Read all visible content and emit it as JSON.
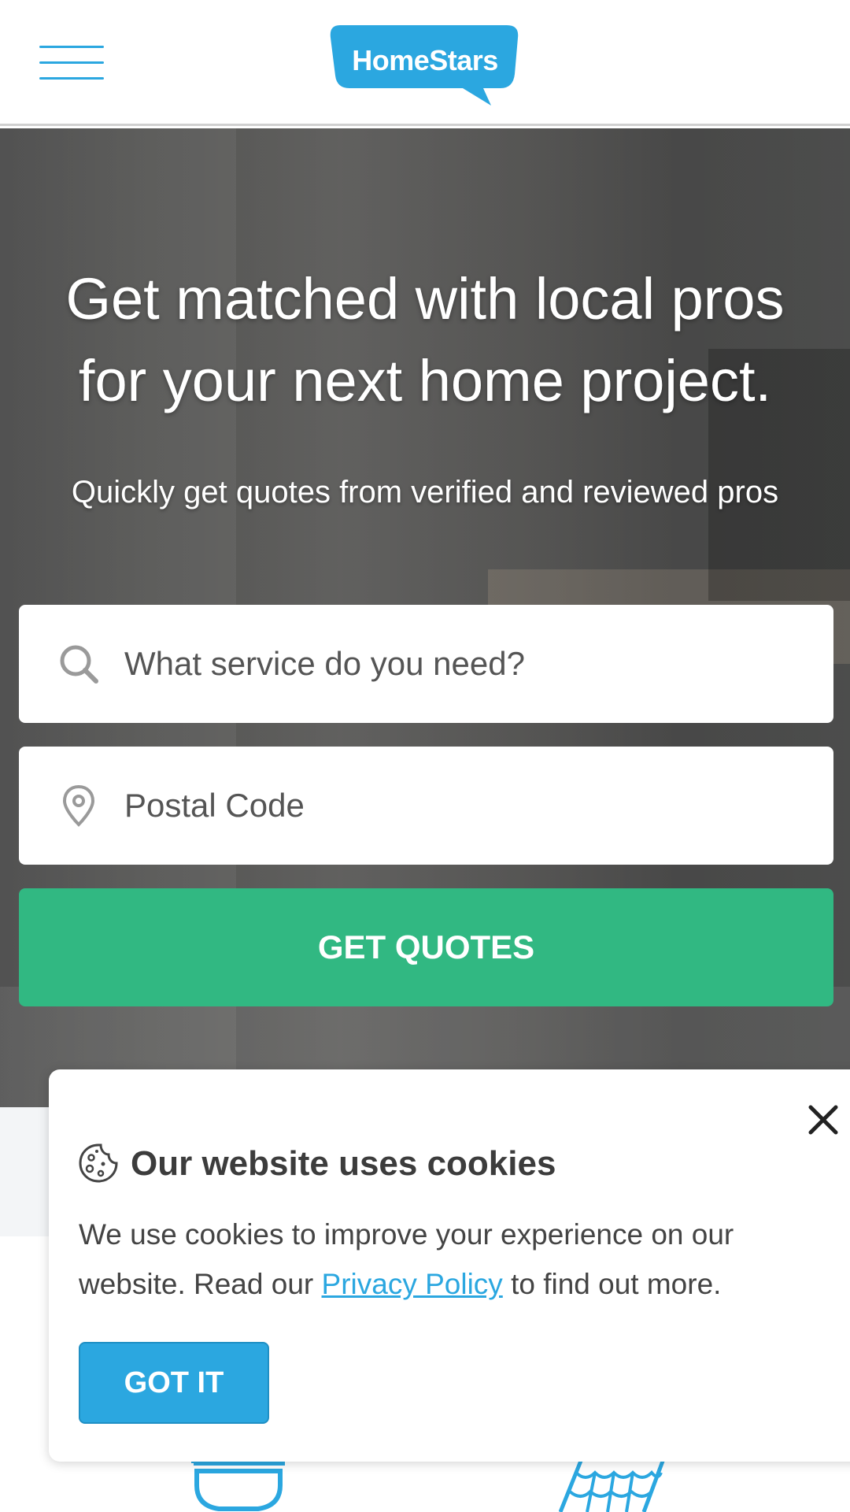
{
  "header": {
    "logo_text": "HomeStars"
  },
  "hero": {
    "title_line1": "Get matched with local pros",
    "title_line2": "for your next home project.",
    "subtitle": "Quickly get quotes from verified and reviewed pros",
    "service_placeholder": "What service do you need?",
    "postal_placeholder": "Postal Code",
    "cta_label": "GET QUOTES"
  },
  "cookie": {
    "title": "Our website uses cookies",
    "text_before": "We use cookies to improve your experience on our website. Read our ",
    "link_text": "Privacy Policy",
    "text_after": " to find out more.",
    "button_label": "GOT IT"
  },
  "colors": {
    "brand_blue": "#2ba7e0",
    "cta_green": "#31b882"
  },
  "icons": [
    "hamburger-menu-icon",
    "search-icon",
    "location-pin-icon",
    "close-icon",
    "cookie-icon",
    "bathtub-icon",
    "roof-icon"
  ]
}
